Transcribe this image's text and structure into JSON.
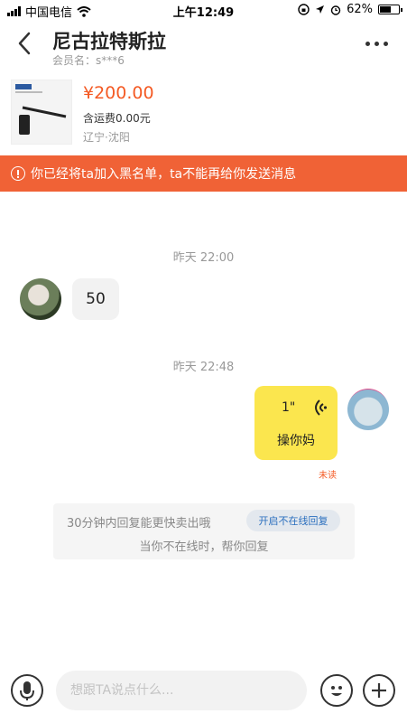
{
  "status_bar": {
    "carrier": "中国电信",
    "time": "上午12:49",
    "battery": "62%",
    "battery_level": 0.62,
    "icons": [
      "signal-icon",
      "wifi-icon",
      "rotation-lock-icon",
      "location-icon",
      "alarm-icon",
      "battery-icon"
    ]
  },
  "header": {
    "title": "尼古拉特斯拉",
    "subtitle": "会员名：s***6",
    "back_icon": "back-arrow-icon",
    "more_icon": "more-icon"
  },
  "product": {
    "price": "¥200.00",
    "shipping": "含运费0.00元",
    "location": "辽宁·沈阳",
    "image_icon": "product-thumbnail"
  },
  "warning": {
    "text": "你已经将ta加入黑名单，ta不能再给你发送消息",
    "icon": "warning-icon"
  },
  "messages": [
    {
      "timestamp": "昨天 22:00",
      "side": "left",
      "text": "50"
    },
    {
      "timestamp": "昨天 22:48",
      "side": "right",
      "voice_duration": "1\"",
      "text": "操你妈",
      "status": "未读"
    }
  ],
  "tip": {
    "line1": "30分钟内回复能更快卖出哦",
    "button": "开启不在线回复",
    "line2": "当你不在线时，帮你回复"
  },
  "input_bar": {
    "placeholder": "想跟TA说点什么...",
    "icons": [
      "microphone-icon",
      "emoji-icon",
      "plus-icon"
    ]
  },
  "colors": {
    "accent": "#f45a24",
    "warning_bg": "#f06236",
    "bubble_self": "#fbe64e",
    "bubble_other": "#f2f2f2"
  }
}
